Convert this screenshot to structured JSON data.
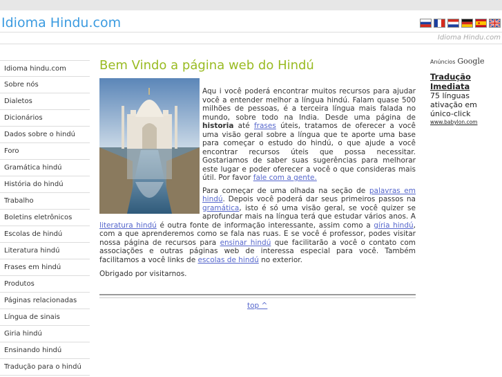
{
  "site": {
    "title": "Idioma Hindu.com",
    "subtitle": "Idioma Hindu.com"
  },
  "flags": [
    "russia-flag-icon",
    "france-flag-icon",
    "paraguay-flag-icon",
    "germany-flag-icon",
    "spain-flag-icon",
    "uk-flag-icon"
  ],
  "sidebar": {
    "items": [
      {
        "label": "Idioma hindu.com"
      },
      {
        "label": "Sobre nós"
      },
      {
        "label": "Dialetos"
      },
      {
        "label": "Dicionários"
      },
      {
        "label": "Dados sobre o hindú"
      },
      {
        "label": "Foro"
      },
      {
        "label": "Gramática hindú"
      },
      {
        "label": "História do hindú"
      },
      {
        "label": "Trabalho"
      },
      {
        "label": "Boletins eletrônicos"
      },
      {
        "label": "Escolas de hindú"
      },
      {
        "label": "Literatura hindú"
      },
      {
        "label": "Frases em hindú"
      },
      {
        "label": "Produtos"
      },
      {
        "label": "Páginas relacionadas"
      },
      {
        "label": "Língua de sinais"
      },
      {
        "label": "Giria hindú"
      },
      {
        "label": "Ensinando hindú"
      },
      {
        "label": "Tradução para o hindú"
      }
    ]
  },
  "main": {
    "title": "Bem Vindo a página web do Hindú",
    "p1": {
      "t1": "Aqu i você poderá encontrar muitos recursos para ajudar você a entender melhor a língua hindú. Falam quase 500 milhões de pessoas, é a terceira língua mais falada no mundo, sobre todo na India. Desde uma página de ",
      "b1": "historia",
      "t2": " até ",
      "l1": "frases",
      "t3": " úteis, tratamos de oferecer a você uma visão geral sobre a língua que te aporte uma base para começar o estudo do hindú, o que ajude a você encontrar recursos úteis que possa necessitar. Gostariamos de saber suas sugerências para melhorar este lugar e poder oferecer a você o que consideras mais útil. Por favor ",
      "l2": "fale com a gente."
    },
    "p2": {
      "t1": "Para começar de uma olhada na seção de ",
      "l1": "palavras em hindú",
      "t2": ". Depois você poderá dar seus primeiros passos na ",
      "l2": "gramática",
      "t3": ", isto é só uma visão geral, se você quizer se aprofundar mais na língua terá que estudar vários anos. A ",
      "l3": "literatura hindú",
      "t4": " é outra fonte de informação interessante, assim como a ",
      "l4": "gíria hindú",
      "t5": ", com a que aprenderemos como se fala nas ruas. E se você é professor, podes visitar nossa página de recursos para ",
      "l5": "ensinar hindú",
      "t6": " que facilitarão a você o contato com associações e outras páginas web de interessa especial para você. Também facilitamos a você links de ",
      "l6": "escolas de hindú",
      "t7": " no exterior."
    },
    "thanks": "Obrigado por visitarnos.",
    "top_link": "top ^"
  },
  "ad": {
    "label": "Anúncios",
    "logo_text": "Google",
    "title": "Tradução Imediata",
    "text": "75 línguas ativação em único-click",
    "url": "www.babylon.com"
  }
}
